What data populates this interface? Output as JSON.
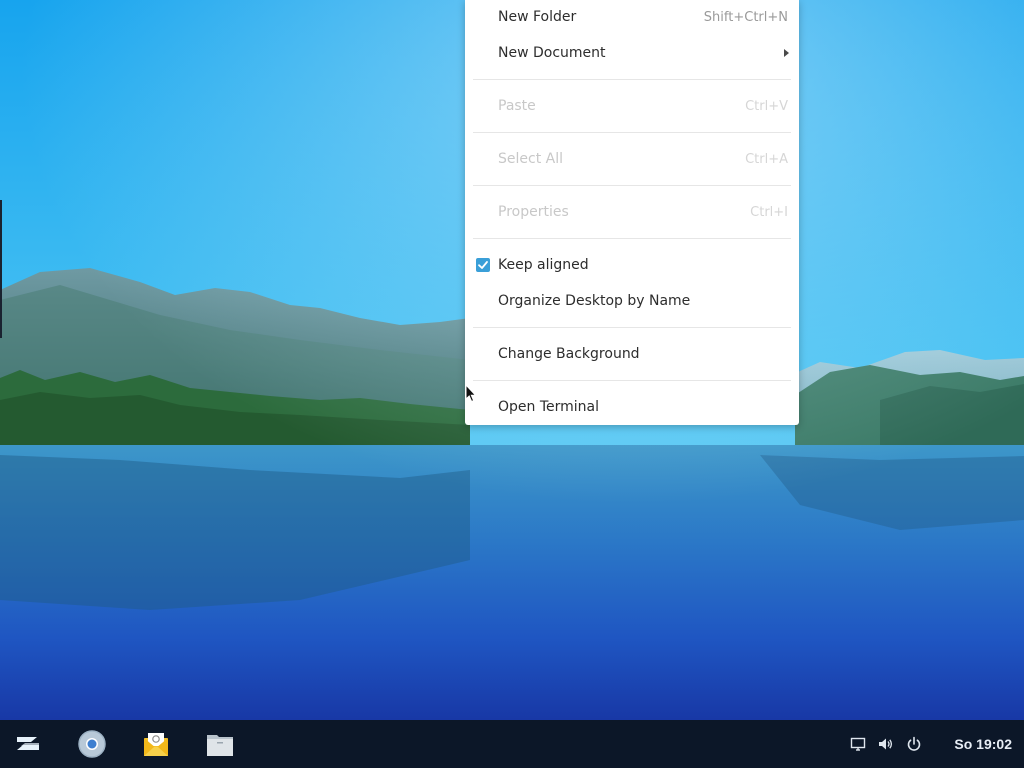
{
  "context_menu": {
    "items": [
      {
        "label": "New Folder",
        "shortcut": "Shift+Ctrl+N",
        "enabled": true
      },
      {
        "label": "New Document",
        "submenu": true,
        "enabled": true
      },
      {
        "label": "Paste",
        "shortcut": "Ctrl+V",
        "enabled": false
      },
      {
        "label": "Select All",
        "shortcut": "Ctrl+A",
        "enabled": false
      },
      {
        "label": "Properties",
        "shortcut": "Ctrl+I",
        "enabled": false
      },
      {
        "label": "Keep aligned",
        "checked": true,
        "enabled": true
      },
      {
        "label": "Organize Desktop by Name",
        "enabled": true
      },
      {
        "label": "Change Background",
        "enabled": true
      },
      {
        "label": "Open Terminal",
        "enabled": true
      }
    ]
  },
  "taskbar": {
    "launchers": [
      {
        "icon": "zorin-menu-icon"
      },
      {
        "icon": "chromium-browser-icon"
      },
      {
        "icon": "mail-icon"
      },
      {
        "icon": "files-icon"
      }
    ],
    "tray": [
      {
        "icon": "display-icon"
      },
      {
        "icon": "volume-icon"
      },
      {
        "icon": "power-icon"
      }
    ],
    "clock": "So 19:02"
  },
  "colors": {
    "taskbar_bg": "#0c1728",
    "accent": "#3a9fd8",
    "menu_bg": "#ffffff"
  }
}
